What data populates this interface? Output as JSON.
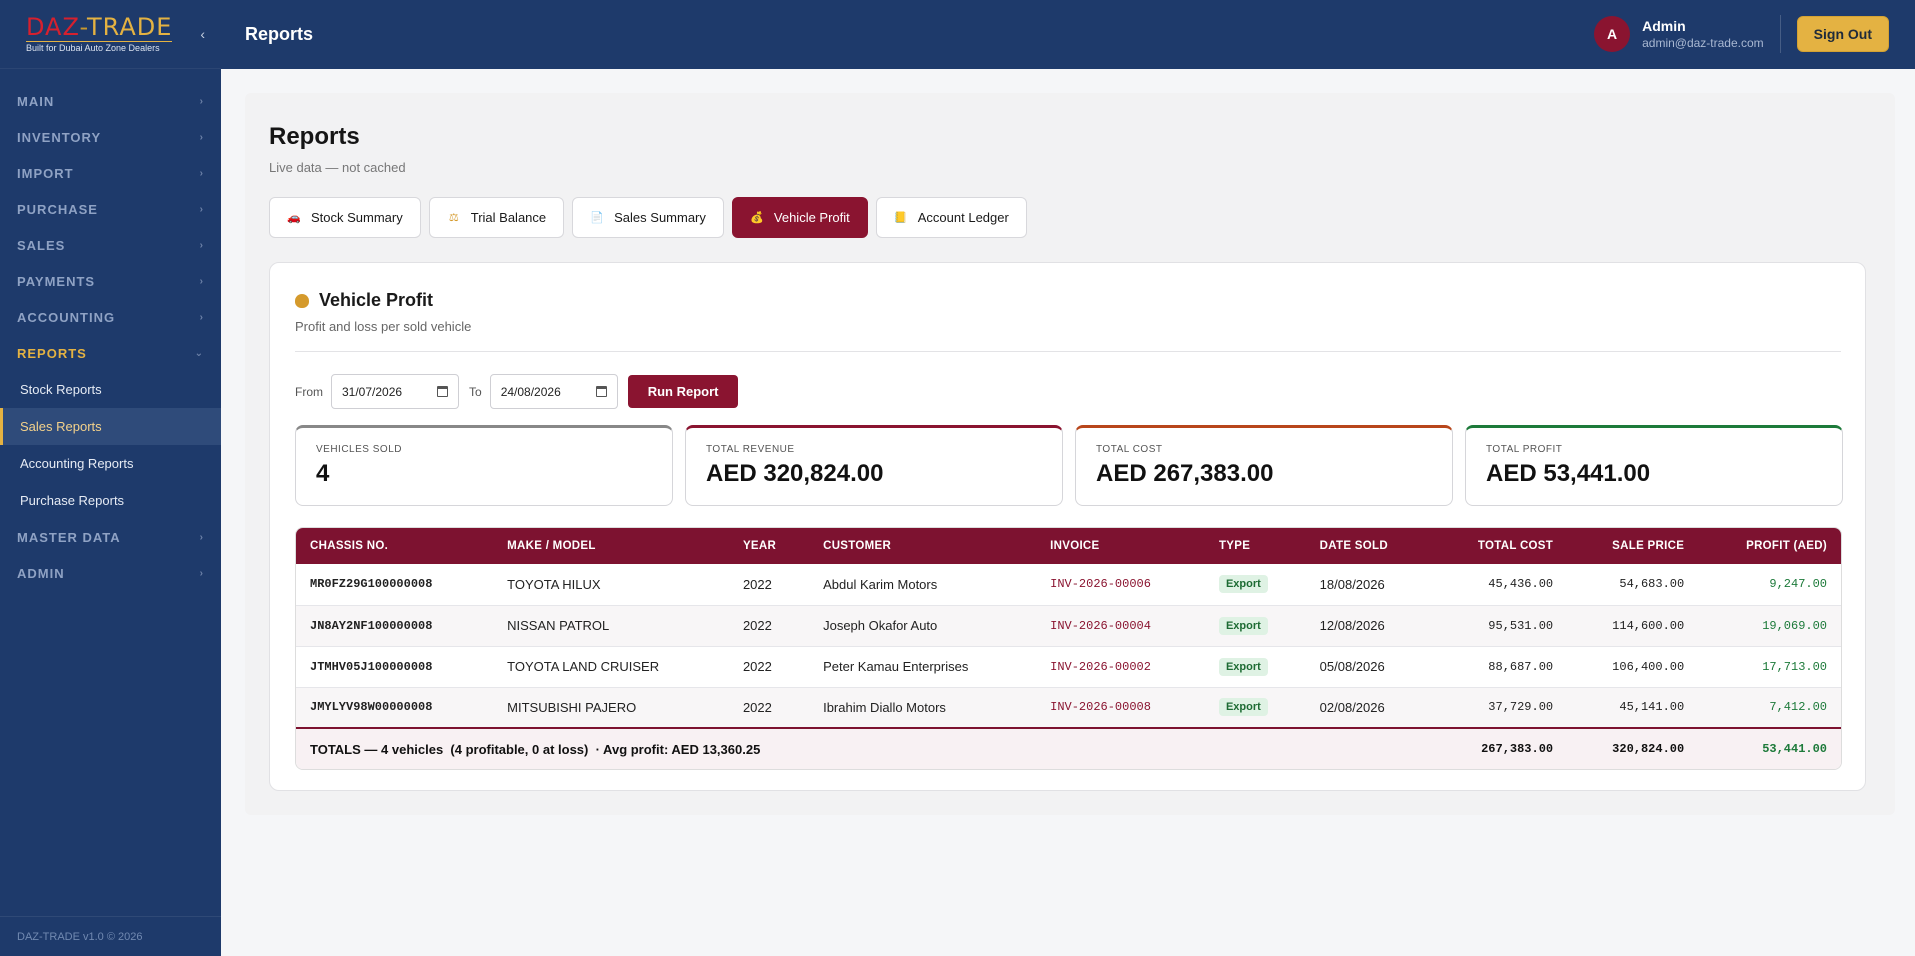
{
  "brand": {
    "logo_daz": "DAZ",
    "logo_dash": "-",
    "logo_trade": "TRADE",
    "tagline": "Built for Dubai Auto Zone Dealers",
    "collapse": "‹"
  },
  "sidebar": {
    "groups": [
      {
        "label": "MAIN",
        "chev": "›"
      },
      {
        "label": "INVENTORY",
        "chev": "›"
      },
      {
        "label": "IMPORT",
        "chev": "›"
      },
      {
        "label": "PURCHASE",
        "chev": "›"
      },
      {
        "label": "SALES",
        "chev": "›"
      },
      {
        "label": "PAYMENTS",
        "chev": "›"
      },
      {
        "label": "ACCOUNTING",
        "chev": "›"
      },
      {
        "label": "REPORTS",
        "chev": "⌄"
      },
      {
        "label": "MASTER DATA",
        "chev": "›"
      },
      {
        "label": "ADMIN",
        "chev": "›"
      }
    ],
    "report_items": [
      "Stock Reports",
      "Sales Reports",
      "Accounting Reports",
      "Purchase Reports"
    ],
    "footer": "DAZ-TRADE v1.0 © 2026"
  },
  "header": {
    "title": "Reports",
    "avatar_letter": "A",
    "user_name": "Admin",
    "user_email": "admin@daz-trade.com",
    "signout_label": "Sign Out"
  },
  "page": {
    "title": "Reports",
    "subtitle": "Live data — not cached"
  },
  "tabs": [
    {
      "label": "Stock Summary",
      "icon": "car-icon",
      "glyph": "🚗"
    },
    {
      "label": "Trial Balance",
      "icon": "scale-icon",
      "glyph": "⚖"
    },
    {
      "label": "Sales Summary",
      "icon": "document-icon",
      "glyph": "📄"
    },
    {
      "label": "Vehicle Profit",
      "icon": "money-bag-icon",
      "glyph": "💰"
    },
    {
      "label": "Account Ledger",
      "icon": "ledger-icon",
      "glyph": "📒"
    }
  ],
  "report": {
    "title": "Vehicle Profit",
    "subtitle": "Profit and loss per sold vehicle",
    "from_label": "From",
    "from_value": "31/07/2026",
    "to_label": "To",
    "to_value": "24/08/2026",
    "run_label": "Run Report"
  },
  "stats": {
    "vehicles_label": "VEHICLES SOLD",
    "vehicles_value": "4",
    "revenue_label": "TOTAL REVENUE",
    "revenue_value": "AED 320,824.00",
    "cost_label": "TOTAL COST",
    "cost_value": "AED 267,383.00",
    "profit_label": "TOTAL PROFIT",
    "profit_value": "AED 53,441.00"
  },
  "table": {
    "headers": [
      "CHASSIS NO.",
      "MAKE / MODEL",
      "YEAR",
      "CUSTOMER",
      "INVOICE",
      "TYPE",
      "DATE SOLD",
      "TOTAL COST",
      "SALE PRICE",
      "PROFIT (AED)"
    ],
    "rows": [
      {
        "chassis": "MR0FZ29G100000008",
        "model": "TOYOTA HILUX",
        "year": "2022",
        "customer": "Abdul Karim Motors",
        "invoice": "INV-2026-00006",
        "type": "Export",
        "date": "18/08/2026",
        "cost": "45,436.00",
        "price": "54,683.00",
        "profit": "9,247.00"
      },
      {
        "chassis": "JN8AY2NF100000008",
        "model": "NISSAN PATROL",
        "year": "2022",
        "customer": "Joseph Okafor Auto",
        "invoice": "INV-2026-00004",
        "type": "Export",
        "date": "12/08/2026",
        "cost": "95,531.00",
        "price": "114,600.00",
        "profit": "19,069.00"
      },
      {
        "chassis": "JTMHV05J100000008",
        "model": "TOYOTA LAND CRUISER",
        "year": "2022",
        "customer": "Peter Kamau Enterprises",
        "invoice": "INV-2026-00002",
        "type": "Export",
        "date": "05/08/2026",
        "cost": "88,687.00",
        "price": "106,400.00",
        "profit": "17,713.00"
      },
      {
        "chassis": "JMYLYV98W00000008",
        "model": "MITSUBISHI PAJERO",
        "year": "2022",
        "customer": "Ibrahim Diallo Motors",
        "invoice": "INV-2026-00008",
        "type": "Export",
        "date": "02/08/2026",
        "cost": "37,729.00",
        "price": "45,141.00",
        "profit": "7,412.00"
      }
    ],
    "totals": {
      "label": "TOTALS — 4 vehicles  (4 profitable, 0 at loss)  · Avg profit: AED 13,360.25",
      "cost": "267,383.00",
      "price": "320,824.00",
      "profit": "53,441.00"
    }
  },
  "colors": {
    "navy": "#1e3a6b",
    "maroon": "#8a1430",
    "gold": "#e4b242",
    "profit_green": "#1d7a3a"
  }
}
